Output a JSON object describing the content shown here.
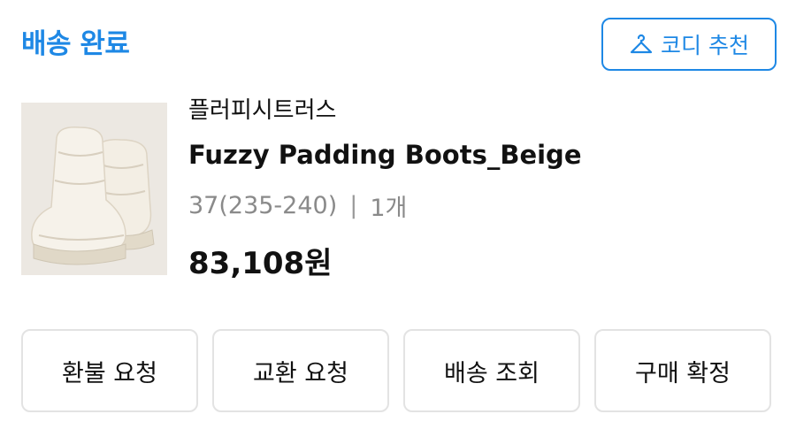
{
  "order": {
    "status": "배송 완료",
    "coordi_button": {
      "label": "코디 추천",
      "icon": "hanger-icon"
    }
  },
  "product": {
    "brand": "플러피시트러스",
    "name": "Fuzzy Padding Boots_Beige",
    "option": "37(235-240)",
    "separator": "|",
    "quantity": "1개",
    "price": "83,108원",
    "image_alt": "Fuzzy Padding Boots_Beige"
  },
  "actions": {
    "refund": "환불 요청",
    "exchange": "교환 요청",
    "tracking": "배송 조회",
    "confirm": "구매 확정"
  },
  "colors": {
    "accent": "#1e88e5",
    "text": "#111111",
    "muted": "#8a8a8a",
    "border": "#e3e3e3"
  }
}
